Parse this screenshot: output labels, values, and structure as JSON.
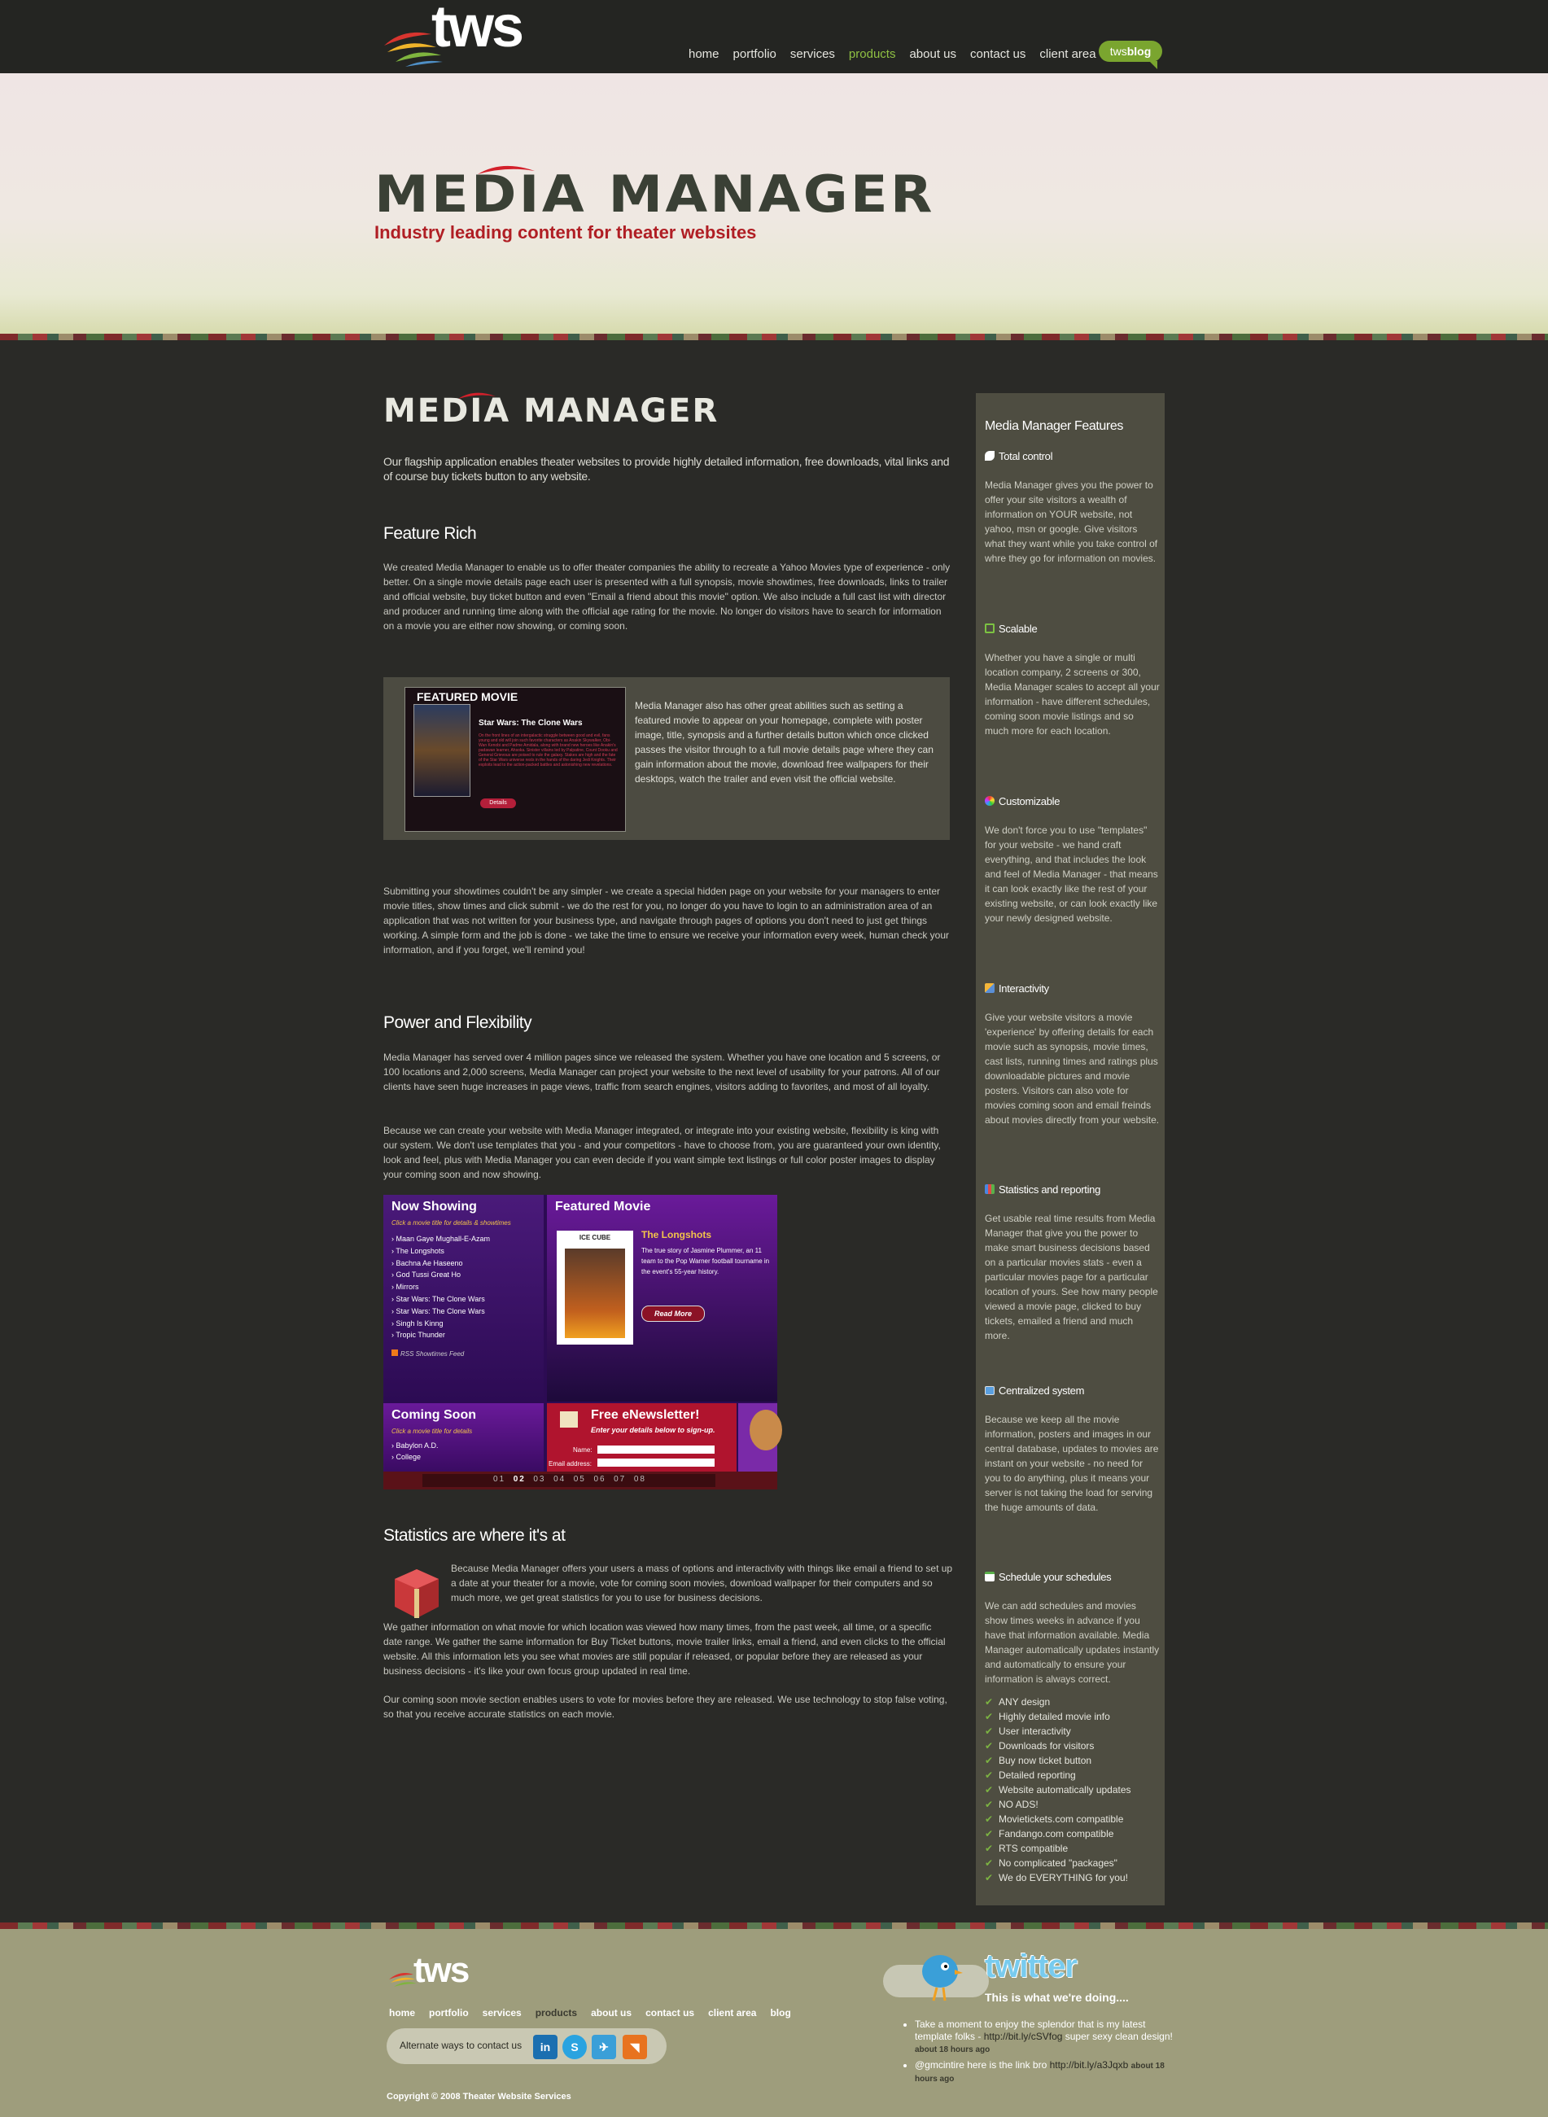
{
  "header": {
    "logo_text": "tws",
    "nav": [
      "home",
      "portfolio",
      "services",
      "products",
      "about us",
      "contact us",
      "client area"
    ],
    "active_nav": "products",
    "blog_prefix": "tws",
    "blog_suffix": "blog"
  },
  "banner": {
    "title": "MEDIA MANAGER",
    "subtitle": "Industry leading content for theater websites"
  },
  "main": {
    "title": "MEDIA MANAGER",
    "lead": "Our flagship application enables theater websites to provide highly detailed information, free downloads, vital links and of course buy tickets button to any website.",
    "feature_rich": {
      "heading": "Feature Rich",
      "text": "We created Media Manager to enable us to offer theater companies the ability to recreate a Yahoo Movies type of experience - only better. On a single movie details page each user is presented with a full synopsis, movie showtimes, free downloads, links to trailer and official website, buy ticket button and even \"Email a friend about this movie\" option. We also include a full cast list with director and producer and running time along with the official age rating for the movie. No longer do visitors have to search for information on a movie you are either now showing, or coming soon."
    },
    "featured": {
      "img_title": "FEATURED MOVIE",
      "img_movie": "Star Wars: The Clone Wars",
      "img_desc": "On the front lines of an intergalactic struggle between good and evil, fans young and old will join such favorite characters as Anakin Skywalker, Obi-Wan Kenobi and Padme Amidala, along with brand new heroes like Anakin's padawan learner, Ahsoka. Sinister villains led by Palpatine, Count Dooku and General Grievous are poised to rule the galaxy. Stakes are high and the fate of the Star Wars universe rests in the hands of the daring Jedi Knights. Their exploits lead to the action-packed battles and astonishing new revelations.",
      "img_button": "Details",
      "text": "Media Manager also has other great abilities such as setting a featured movie to appear on your homepage, complete with poster image, title, synopsis and a further details button which once clicked passes the visitor through to a full movie details page where they can gain information about the movie, download free wallpapers for their desktops, watch the trailer and even visit the official website."
    },
    "showtimes_text": "Submitting your showtimes couldn't be any simpler - we create a special hidden page on your website for your managers to enter movie titles, show times and click submit - we do the rest for you, no longer do you have to login to an administration area of an application that was not written for your business type, and navigate through pages of options you don't need to just get things working. A simple form and the job is done - we take the time to ensure we receive your information every week, human check your information, and if you forget, we'll remind you!",
    "power": {
      "heading": "Power and Flexibility",
      "p1": "Media Manager has served over 4 million pages since we released the system. Whether you have one location and 5 screens, or 100 locations and 2,000 screens, Media Manager can project your website to the next level of usability for your patrons. All of our clients have seen huge increases in page views, traffic from search engines, visitors adding to favorites, and most of all loyalty.",
      "p2": "Because we can create your website with Media Manager integrated, or integrate into your existing website, flexibility is king with our system. We don't use templates that you - and your competitors - have to choose from, you are guaranteed your own identity, look and feel, plus with Media Manager you can even decide if you want simple text listings or full color poster images to display your coming soon and now showing."
    },
    "screens": {
      "now_showing": "Now Showing",
      "now_hint": "Click a movie title for details & showtimes",
      "now_list": [
        "Maan Gaye Mughall-E-Azam",
        "The Longshots",
        "Bachna Ae Haseeno",
        "God Tussi Great Ho",
        "Mirrors",
        "Star Wars: The Clone Wars",
        "Star Wars: The Clone Wars",
        "Singh Is Kinng",
        "Tropic Thunder"
      ],
      "rss": "RSS Showtimes Feed",
      "featured_title": "Featured Movie",
      "featured_movie": "The Longshots",
      "featured_desc": "The true story of Jasmine Plummer, an 11 team to the Pop Warner football tourname in the event's 55-year history.",
      "poster_credit": "ICE CUBE",
      "read_more": "Read More",
      "coming_soon": "Coming Soon",
      "coming_hint": "Click a movie title for details",
      "coming_list": [
        "Babylon A.D.",
        "College"
      ],
      "newsletter_title": "Free eNewsletter!",
      "newsletter_sub": "Enter your details below to sign-up.",
      "name_label": "Name:",
      "email_label": "Email address:",
      "pager": [
        "01",
        "02",
        "03",
        "04",
        "05",
        "06",
        "07",
        "08"
      ],
      "pager_active": "02"
    },
    "stats": {
      "heading": "Statistics are where it's at",
      "p1": "Because Media Manager offers your users a mass of options and interactivity with things like email a friend to set up a date at your theater for a movie, vote for coming soon movies, download wallpaper for their computers and so much more, we get great statistics for you to use for business decisions.",
      "p2": "We gather information on what movie for which location was viewed how many times, from the past week, all time, or a specific date range. We gather the same information for Buy Ticket buttons, movie trailer links, email a friend, and even clicks to the official website. All this information lets you see what movies are still popular if released, or popular before they are released as your business decisions - it's like your own focus group updated in real time.",
      "p3": "Our coming soon movie section enables users to vote for movies before they are released. We use technology to stop false voting, so that you receive accurate statistics on each movie."
    }
  },
  "sidebar": {
    "title": "Media Manager Features",
    "sections": [
      {
        "heading": "Total control",
        "text": "Media Manager gives you the power to offer your site visitors a wealth of information on YOUR website, not yahoo, msn or google. Give visitors what they want while you take control of whre they go for information on movies."
      },
      {
        "heading": "Scalable",
        "text": "Whether you have a single or multi location company, 2 screens or 300, Media Manager scales to accept all your information - have different schedules, coming soon movie listings and so much more for each location."
      },
      {
        "heading": "Customizable",
        "text": "We don't force you to use \"templates\" for your website - we hand craft everything, and that includes the look and feel of Media Manager - that means it can look exactly like the rest of your existing website, or can look exactly like your newly designed website."
      },
      {
        "heading": "Interactivity",
        "text": "Give your website visitors a movie 'experience' by offering details for each movie such as synopsis, movie times, cast lists, running times and ratings plus downloadable pictures and movie posters. Visitors can also vote for movies coming soon and email freinds about movies directly from your website."
      },
      {
        "heading": "Statistics and reporting",
        "text": "Get usable real time results from Media Manager that give you the power to make smart business decisions based on a particular movies stats - even a particular movies page for a particular location of yours. See how many people viewed a movie page, clicked to buy tickets, emailed a friend and much more."
      },
      {
        "heading": "Centralized system",
        "text": "Because we keep all the movie information, posters and images in our central database, updates to movies are instant on your website - no need for you to do anything, plus it means your server is not taking the load for serving the huge amounts of data."
      },
      {
        "heading": "Schedule your schedules",
        "text": "We can add schedules and movies show times weeks in advance if you have that information available. Media Manager automatically updates instantly and automatically to ensure your information is always correct."
      }
    ],
    "checklist": [
      "ANY design",
      "Highly detailed movie info",
      "User interactivity",
      "Downloads for visitors",
      "Buy now ticket button",
      "Detailed reporting",
      "Website automatically updates",
      "NO ADS!",
      "Movietickets.com compatible",
      "Fandango.com compatible",
      "RTS compatible",
      "No complicated \"packages\"",
      "We do EVERYTHING for you!"
    ]
  },
  "footer": {
    "logo_text": "tws",
    "nav": [
      "home",
      "portfolio",
      "services",
      "products",
      "about us",
      "contact us",
      "client area",
      "blog"
    ],
    "active_nav": "products",
    "contact_label": "Alternate ways to contact us",
    "copyright": "Copyright © 2008 Theater Website Services",
    "twitter_word": "twitter",
    "twitter_sub": "This is what we're doing....",
    "tweets": [
      {
        "text": "Take a moment to enjoy the splendor that is my latest template folks - ",
        "link": "http://bit.ly/cSVfog",
        "tail": " super sexy clean design!",
        "time": "about 18 hours ago"
      },
      {
        "text": "@gmcintire",
        "link": "",
        "tail": " here is the link bro ",
        "link2": "http://bit.ly/a3Jqxb",
        "time": "about 18 hours ago"
      }
    ]
  }
}
